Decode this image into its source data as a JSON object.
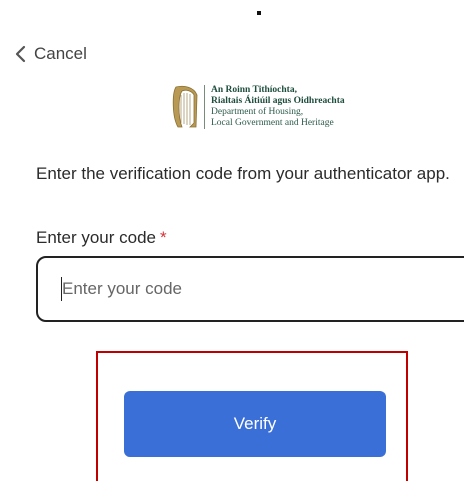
{
  "nav": {
    "cancel_label": "Cancel",
    "cancel_icon": "chevron-left-icon"
  },
  "logo": {
    "line1": "An Roinn Tithíochta,",
    "line2": "Rialtais Áitiúil agus Oidhreachta",
    "line3": "Department of Housing,",
    "line4": "Local Government and Heritage",
    "emblem": "harp-icon",
    "brand_color": "#1e4d3d"
  },
  "form": {
    "instruction": "Enter the verification code from your authenticator app.",
    "code_label": "Enter your code",
    "required_marker": "*",
    "code_value": "",
    "code_placeholder": "Enter your code",
    "verify_label": "Verify"
  },
  "colors": {
    "button": "#3b6fd8",
    "required": "#d13438",
    "highlight_border": "#c00000"
  }
}
